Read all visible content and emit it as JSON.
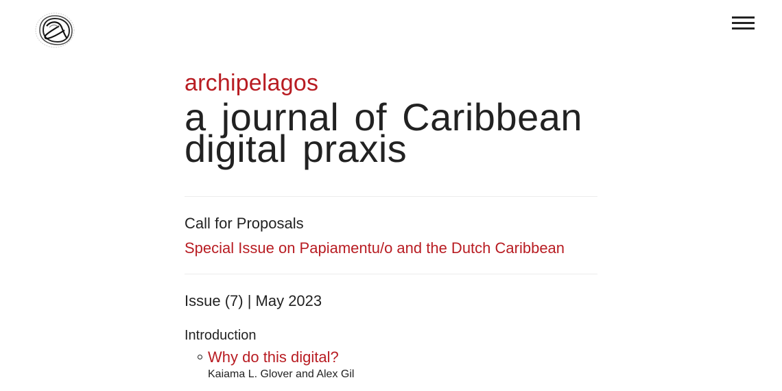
{
  "header": {
    "logo_icon": "archipelagos-logo-icon",
    "menu_icon": "hamburger-menu-icon"
  },
  "hero": {
    "site_name": "archipelagos",
    "tagline": "a journal of Caribbean digital praxis"
  },
  "cfp": {
    "title": "Call for Proposals",
    "link_label": "Special Issue on Papiamentu/o and the Dutch Caribbean"
  },
  "issue": {
    "title": "Issue (7) | May 2023",
    "sections": [
      {
        "title": "Introduction",
        "articles": [
          {
            "title": "Why do this digital?",
            "authors": "Kaiama L. Glover and Alex Gil"
          }
        ]
      }
    ]
  },
  "colors": {
    "accent": "#b81c22",
    "text": "#222222",
    "divider": "#ececec",
    "background": "#ffffff"
  }
}
